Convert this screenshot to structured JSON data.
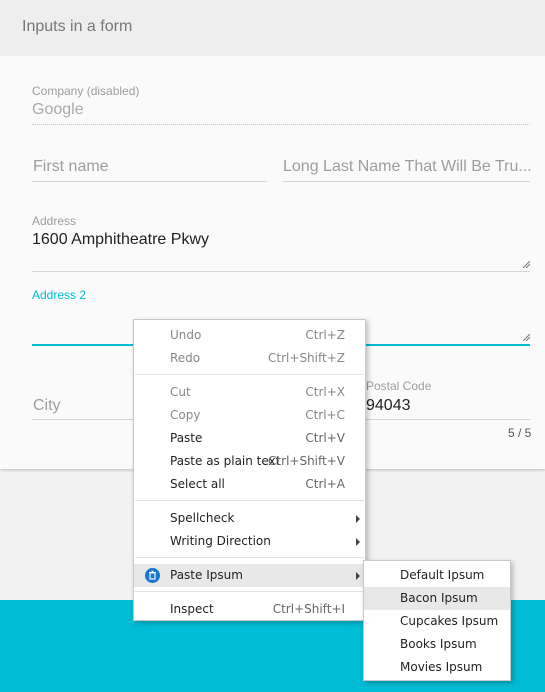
{
  "card": {
    "title": "Inputs in a form"
  },
  "form": {
    "company": {
      "label": "Company (disabled)",
      "value": "Google"
    },
    "first_name": {
      "placeholder": "First name"
    },
    "last_name": {
      "placeholder": "Long Last Name That Will Be Tru..."
    },
    "address": {
      "label": "Address",
      "value": "1600 Amphitheatre Pkwy"
    },
    "address2": {
      "label": "Address 2",
      "value": ""
    },
    "city": {
      "placeholder": "City"
    },
    "postal_code": {
      "label": "Postal Code",
      "value": "94043",
      "counter": "5 / 5"
    }
  },
  "context_menu": {
    "undo": {
      "label": "Undo",
      "shortcut": "Ctrl+Z"
    },
    "redo": {
      "label": "Redo",
      "shortcut": "Ctrl+Shift+Z"
    },
    "cut": {
      "label": "Cut",
      "shortcut": "Ctrl+X"
    },
    "copy": {
      "label": "Copy",
      "shortcut": "Ctrl+C"
    },
    "paste": {
      "label": "Paste",
      "shortcut": "Ctrl+V"
    },
    "paste_plain": {
      "label": "Paste as plain text",
      "shortcut": "Ctrl+Shift+V"
    },
    "select_all": {
      "label": "Select all",
      "shortcut": "Ctrl+A"
    },
    "spellcheck": {
      "label": "Spellcheck"
    },
    "writing_direction": {
      "label": "Writing Direction"
    },
    "paste_ipsum": {
      "label": "Paste Ipsum",
      "icon": "trash-can-icon"
    },
    "inspect": {
      "label": "Inspect",
      "shortcut": "Ctrl+Shift+I"
    }
  },
  "submenu": {
    "items": [
      "Default Ipsum",
      "Bacon Ipsum",
      "Cupcakes Ipsum",
      "Books Ipsum",
      "Movies Ipsum"
    ],
    "highlighted": "Bacon Ipsum"
  },
  "colors": {
    "accent": "#00bcd4",
    "menu_hover": "#e8e8e8",
    "extension_icon": "#1976d2"
  }
}
